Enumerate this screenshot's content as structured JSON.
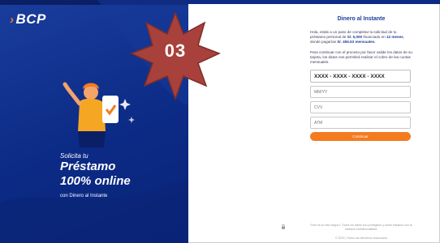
{
  "brand": {
    "logo_text": "BCP",
    "logo_chevron": "›"
  },
  "badge": {
    "text": "03",
    "color": "#a8413b"
  },
  "promo": {
    "line1": "Solicita tu",
    "line2": "Préstamo",
    "line3": "100% online",
    "line4": "con Dinero al Instante"
  },
  "form": {
    "title": "Dinero al Instante",
    "intro_pre": "Hola, estás a un paso de completar la solicitud de tu préstamo personal de ",
    "amount": "S/. 5,000",
    "intro_mid1": " financiado en ",
    "term": "12 meses",
    "intro_mid2": ", donde pagarías ",
    "installment": "S/. 455.53 mensuales.",
    "para2": "Para continuar con el proceso por favor valide los datos de su tarjeta, los datos nos permitirá realizar el cobro de las cuotas mensuales.",
    "card_value": "XXXX - XXXX - XXXX - XXXX",
    "expiry_placeholder": "MM/YY",
    "cvv_placeholder": "CVV",
    "atm_placeholder": "ATM",
    "submit_label": "Continuar"
  },
  "footer": {
    "legal": "Este es un sitio seguro. Todos los datos son protegidos y serán tratados con la máxima confidencialidad.",
    "copyright": "© 2022 | Todos los derechos reservados"
  },
  "colors": {
    "brand_blue": "#0c2b86",
    "accent_orange": "#f47b20",
    "title_blue": "#1a3d9c"
  },
  "icons": [
    "lock-icon"
  ]
}
